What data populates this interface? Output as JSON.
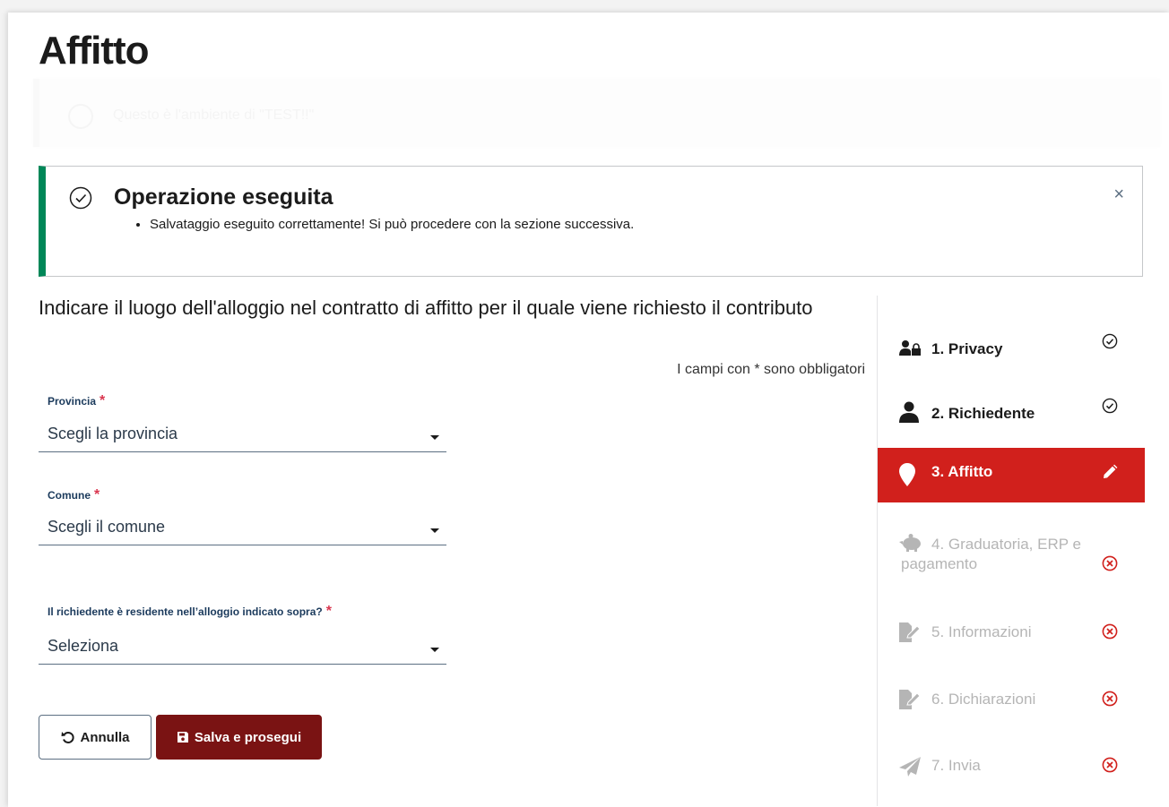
{
  "page": {
    "title": "Affitto"
  },
  "env_notice": {
    "text": "Questo è l'ambiente di \"TEST!!\""
  },
  "success": {
    "title": "Operazione eseguita",
    "message": "Salvataggio eseguito correttamente! Si può procedere con la sezione successiva.",
    "close_label": "×"
  },
  "form": {
    "question": "Indicare il luogo dell'alloggio nel contratto di affitto per il quale viene richiesto il contributo",
    "required_note": "I campi con * sono obbligatori",
    "required_mark": "*",
    "provincia": {
      "label": "Provincia",
      "value": "Scegli la provincia"
    },
    "comune": {
      "label": "Comune",
      "value": "Scegli il comune"
    },
    "residente": {
      "label": "Il richiedente è residente nell’alloggio indicato sopra?",
      "value": "Seleziona"
    }
  },
  "buttons": {
    "annulla": "Annulla",
    "salva": "Salva e prosegui"
  },
  "steps": [
    {
      "label": "1. Privacy",
      "icon": "user-lock-icon",
      "status": "completed"
    },
    {
      "label": "2. Richiedente",
      "icon": "user-icon",
      "status": "completed"
    },
    {
      "label": "3. Affitto",
      "icon": "map-marker-icon",
      "status": "editing"
    },
    {
      "label": "4. Graduatoria, ERP e",
      "label2": "pagamento",
      "icon": "piggy-bank-icon",
      "status": "incomplete"
    },
    {
      "label": "5. Informazioni",
      "icon": "document-edit-icon",
      "status": "incomplete"
    },
    {
      "label": "6. Dichiarazioni",
      "icon": "document-edit-icon",
      "status": "incomplete"
    },
    {
      "label": "7. Invia",
      "icon": "paper-plane-icon",
      "status": "incomplete"
    }
  ],
  "colors": {
    "success": "#008758",
    "active_step": "#d1201c",
    "primary_button": "#7a1313",
    "error": "#d1201c"
  }
}
